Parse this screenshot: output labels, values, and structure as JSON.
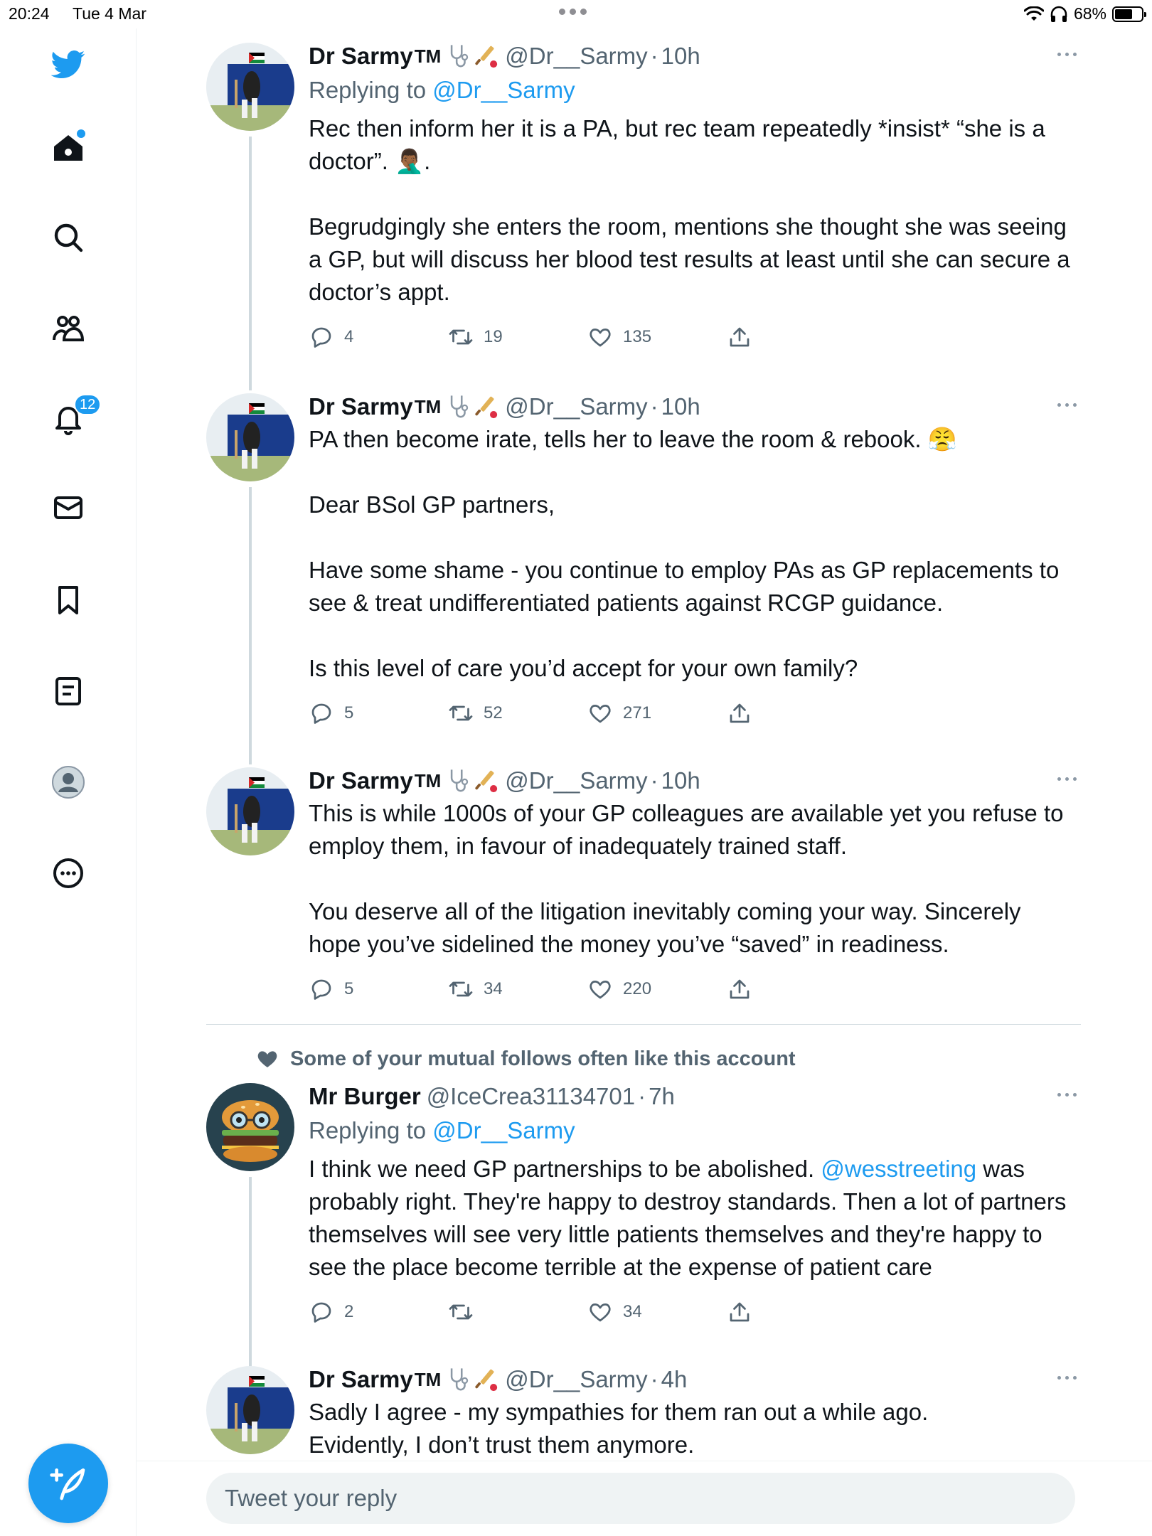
{
  "status_bar": {
    "time": "20:24",
    "date": "Tue 4 Mar",
    "battery": "68%",
    "battery_level": 0.68
  },
  "sidebar": {
    "notifications_count": "12"
  },
  "tweets": [
    {
      "name": "Dr Sarmy",
      "tm": "TM",
      "handle": "@Dr__Sarmy",
      "sep": "·",
      "time": "10h",
      "replying_prefix": "Replying to ",
      "replying_to": "@Dr__Sarmy",
      "text": "Rec then inform her it is a PA, but rec team repeatedly *insist* “she is a doctor”. 🤦🏾‍♂️.\n\nBegrudgingly she enters the room, mentions she thought she was seeing a GP, but will discuss her blood test results at least until she can secure a doctor’s appt.",
      "replies": "4",
      "retweets": "19",
      "likes": "135"
    },
    {
      "name": "Dr Sarmy",
      "tm": "TM",
      "handle": "@Dr__Sarmy",
      "sep": "·",
      "time": "10h",
      "text": "PA then become irate, tells her to leave the room & rebook. 😤\n\nDear BSol GP partners,\n\nHave some shame - you continue to employ PAs as GP replacements to see & treat undifferentiated patients against RCGP guidance.\n\nIs this level of care you’d accept for your own family?",
      "replies": "5",
      "retweets": "52",
      "likes": "271"
    },
    {
      "name": "Dr Sarmy",
      "tm": "TM",
      "handle": "@Dr__Sarmy",
      "sep": "·",
      "time": "10h",
      "text": "This is while 1000s of your GP colleagues are available yet you refuse to employ them, in favour of inadequately trained staff.\n\nYou deserve all of the litigation inevitably coming your way. Sincerely hope you’ve sidelined the money you’ve “saved” in readiness.",
      "replies": "5",
      "retweets": "34",
      "likes": "220"
    },
    {
      "social_context": "Some of your mutual follows often like this account",
      "name": "Mr Burger",
      "handle": "@IceCrea31134701",
      "sep": "·",
      "time": "7h",
      "replying_prefix": "Replying to ",
      "replying_to": "@Dr__Sarmy",
      "text_before": "I think we need GP partnerships to be abolished. ",
      "mention": "@wesstreeting",
      "text_after": " was probably right. They're happy to destroy standards. Then a lot of partners themselves will see very little patients themselves and they're happy to see the place become terrible at the expense of patient care",
      "replies": "2",
      "retweets": "",
      "likes": "34"
    },
    {
      "name": "Dr Sarmy",
      "tm": "TM",
      "handle": "@Dr__Sarmy",
      "sep": "·",
      "time": "4h",
      "text": "Sadly I agree - my sympathies for them ran out a while ago.\nEvidently, I don’t trust them anymore."
    }
  ],
  "reply_bar": {
    "placeholder": "Tweet your reply"
  },
  "colors": {
    "accent": "#1d9bf0",
    "secondary_text": "#536471",
    "divider": "#cfd9de"
  },
  "icons": [
    "twitter-bird-icon",
    "home-icon",
    "search-icon",
    "communities-icon",
    "bell-icon",
    "mail-icon",
    "bookmark-icon",
    "lists-icon",
    "profile-icon",
    "more-circle-icon",
    "compose-icon",
    "reply-icon",
    "retweet-icon",
    "heart-icon",
    "share-icon",
    "stethoscope-icon",
    "cricket-icon"
  ]
}
